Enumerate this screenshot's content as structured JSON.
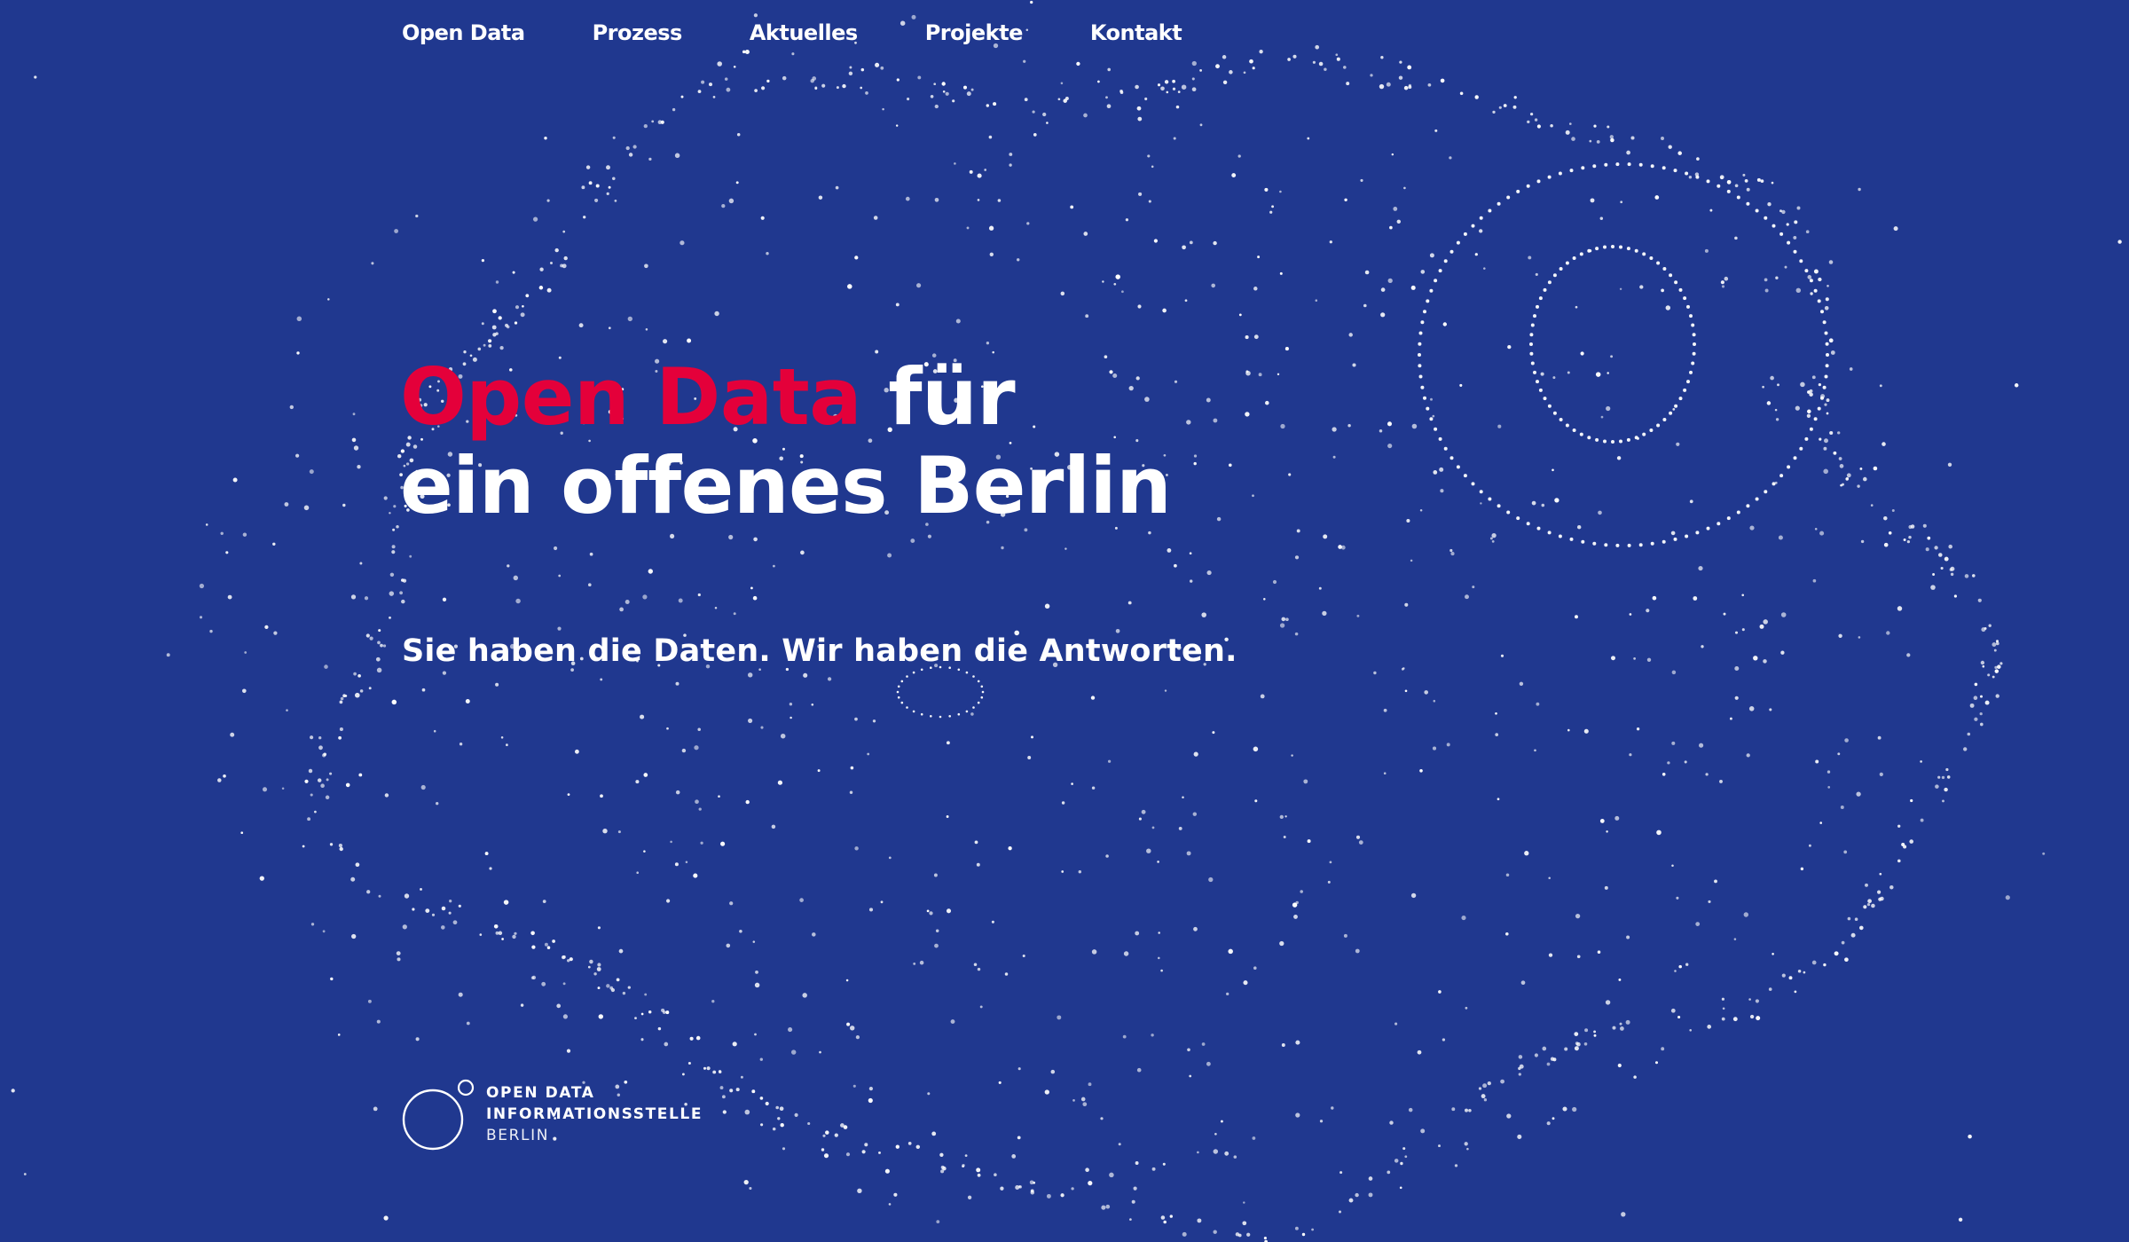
{
  "nav": {
    "items": [
      {
        "label": "Open Data"
      },
      {
        "label": "Prozess"
      },
      {
        "label": "Aktuelles"
      },
      {
        "label": "Projekte"
      },
      {
        "label": "Kontakt"
      }
    ]
  },
  "hero": {
    "headline_accent": "Open Data",
    "headline_rest": " für",
    "headline_line2": "ein offenes Berlin",
    "tagline": "Sie haben die Daten. Wir haben die Antworten."
  },
  "logo": {
    "line1": "OPEN DATA",
    "line2": "INFORMATIONSSTELLE",
    "line3": "BERLIN"
  },
  "colors": {
    "background": "#20388f",
    "accent": "#e4003a",
    "text": "#ffffff"
  }
}
